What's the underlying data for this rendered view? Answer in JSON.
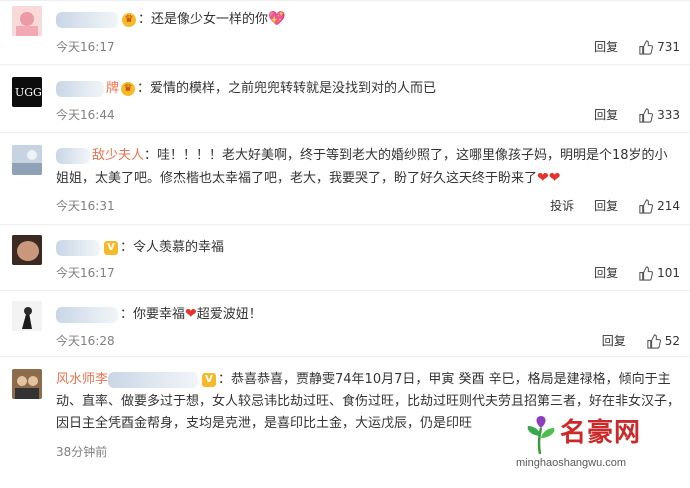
{
  "comments": [
    {
      "name": "",
      "text": "：还是像少女一样的你",
      "time": "今天16:17",
      "reply": "回复",
      "likes": "731"
    },
    {
      "name": "牌",
      "text": "：爱情的模样，之前兜兜转转就是没找到对的人而已",
      "time": "今天16:44",
      "reply": "回复",
      "likes": "333"
    },
    {
      "name": "敌少夫人",
      "text": "：哇！！！！老大好美啊，终于等到老大的婚纱照了，这哪里像孩子妈，明明是个18岁的小姐姐，太美了吧。修杰楷也太幸福了吧，老大，我要哭了，盼了好久这天终于盼来了",
      "time": "今天16:31",
      "report": "投诉",
      "reply": "回复",
      "likes": "214"
    },
    {
      "name": "",
      "text": "：令人羡慕的幸福",
      "time": "今天16:17",
      "reply": "回复",
      "likes": "101"
    },
    {
      "name": "",
      "text": "：你要幸福",
      "text2": "超爱波妞！",
      "time": "今天16:28",
      "reply": "回复",
      "likes": "52"
    },
    {
      "name": "风水师李",
      "text": "：恭喜恭喜，贾静雯74年10月7日，甲寅 癸酉 辛巳，格局是建禄格，倾向于主动、直率、做要多过于想，女人较忌讳比劫过旺、食伤过旺，比劫过旺则代夫劳且招第三者，好在非女汉子，因日主全凭酉金帮身，支均是克泄，是喜印比土金，大运戊辰，仍是印旺",
      "time": "38分钟前"
    }
  ],
  "watermark": {
    "title": "名豪网",
    "url": "minghaoshangwu.com"
  }
}
